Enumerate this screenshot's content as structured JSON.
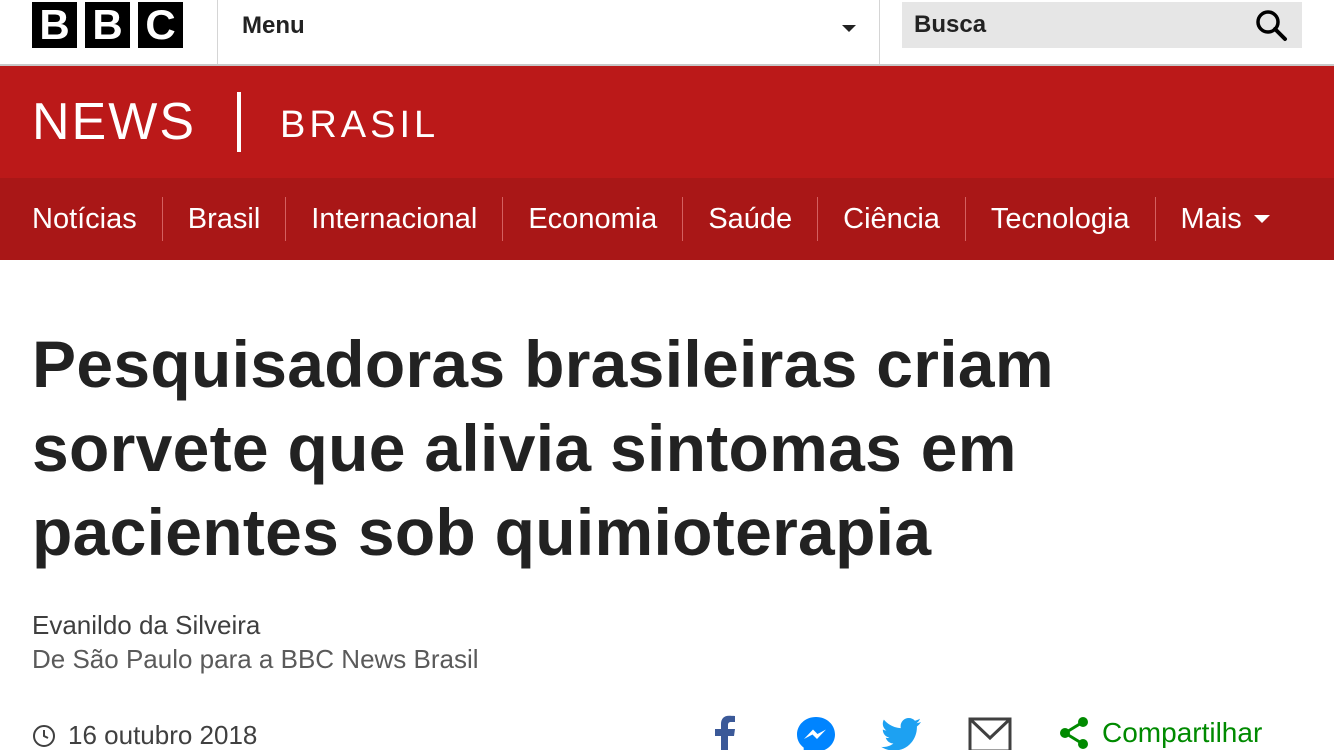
{
  "brand": {
    "letters": [
      "B",
      "B",
      "C"
    ]
  },
  "topbar": {
    "menu_label": "Menu",
    "search_placeholder": "Busca"
  },
  "masthead": {
    "news": "NEWS",
    "edition": "BRASIL"
  },
  "nav": {
    "items": [
      {
        "label": "Notícias"
      },
      {
        "label": "Brasil"
      },
      {
        "label": "Internacional"
      },
      {
        "label": "Economia"
      },
      {
        "label": "Saúde"
      },
      {
        "label": "Ciência"
      },
      {
        "label": "Tecnologia"
      },
      {
        "label": "Mais"
      }
    ]
  },
  "article": {
    "headline": "Pesquisadoras brasileiras criam sorvete que alivia sintomas em pacientes sob quimioterapia",
    "author": "Evanildo da Silveira",
    "author_role": "De São Paulo para a BBC News Brasil",
    "date": "16 outubro 2018"
  },
  "share": {
    "label": "Compartilhar",
    "icons": [
      "facebook-icon",
      "messenger-icon",
      "twitter-icon",
      "email-icon",
      "share-icon"
    ]
  },
  "colors": {
    "masthead": "#bb1919",
    "nav": "#a91717",
    "facebook": "#3b5998",
    "messenger": "#0084ff",
    "twitter": "#1da1f2",
    "share": "#008a00"
  }
}
